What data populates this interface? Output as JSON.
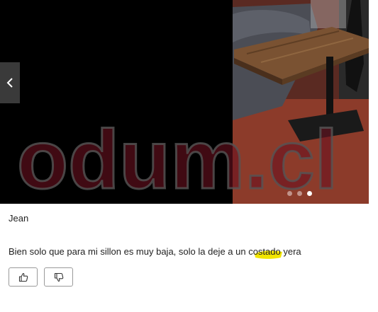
{
  "gallery": {
    "slide_count": 3,
    "active_slide": 3,
    "prev_icon": "chevron-left-icon"
  },
  "watermark": {
    "text": "odum.cl",
    "color": "#6b1020"
  },
  "review": {
    "author": "Jean",
    "text": "Bien solo que para mi sillon es muy baja, solo la deje a un costado yera",
    "highlight_color": "#f2e600"
  },
  "actions": {
    "like_icon": "thumbs-up-icon",
    "dislike_icon": "thumbs-down-icon"
  }
}
